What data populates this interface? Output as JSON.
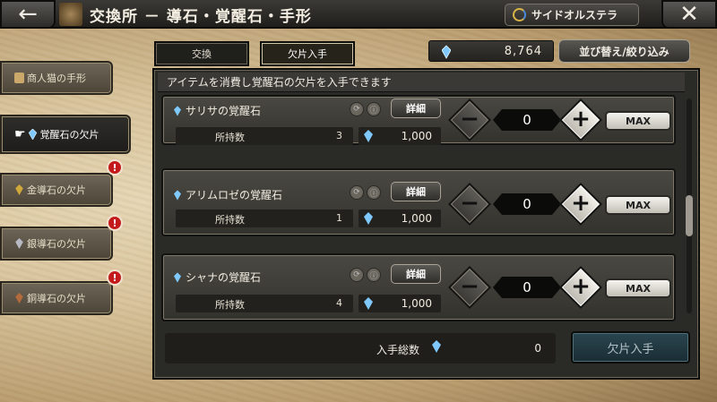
{
  "header": {
    "back_icon": "back-arrow-icon",
    "title": "交換所 － 導石・覚醒石・手形",
    "side_button_label": "サイドオルステラ",
    "close_icon": "close-x-icon"
  },
  "nav": {
    "items": [
      {
        "label": "商人猫の手形",
        "icon": "ticket-icon",
        "alert": false,
        "active": false
      },
      {
        "label": "覚醒石の欠片",
        "icon": "crystal-icon",
        "alert": false,
        "active": true
      },
      {
        "label": "金導石の欠片",
        "icon": "gold-stone-icon",
        "alert": true,
        "active": false
      },
      {
        "label": "銀導石の欠片",
        "icon": "silver-stone-icon",
        "alert": true,
        "active": false
      },
      {
        "label": "銅導石の欠片",
        "icon": "copper-stone-icon",
        "alert": true,
        "active": false
      }
    ],
    "alert_glyph": "!"
  },
  "tabs": [
    {
      "label": "交換",
      "active": false
    },
    {
      "label": "欠片入手",
      "active": true
    }
  ],
  "currency": {
    "value": "8,764",
    "icon": "blue-crystal-icon"
  },
  "sort_button_label": "並び替え/絞り込み",
  "description": "アイテムを消費し覚醒石の欠片を入手できます",
  "items": [
    {
      "name": "サリサの覚醒石",
      "owned_label": "所持数",
      "owned": "3",
      "cost": "1,000",
      "qty": "0",
      "detail_label": "詳細",
      "max_label": "MAX"
    },
    {
      "name": "アリムロゼの覚醒石",
      "owned_label": "所持数",
      "owned": "1",
      "cost": "1,000",
      "qty": "0",
      "detail_label": "詳細",
      "max_label": "MAX"
    },
    {
      "name": "シャナの覚醒石",
      "owned_label": "所持数",
      "owned": "4",
      "cost": "1,000",
      "qty": "0",
      "detail_label": "詳細",
      "max_label": "MAX"
    }
  ],
  "footer": {
    "total_label": "入手総数",
    "total_value": "0",
    "obtain_button_label": "欠片入手"
  },
  "glyphs": {
    "minus": "−",
    "plus": "+",
    "back": "←",
    "close": "✕"
  }
}
